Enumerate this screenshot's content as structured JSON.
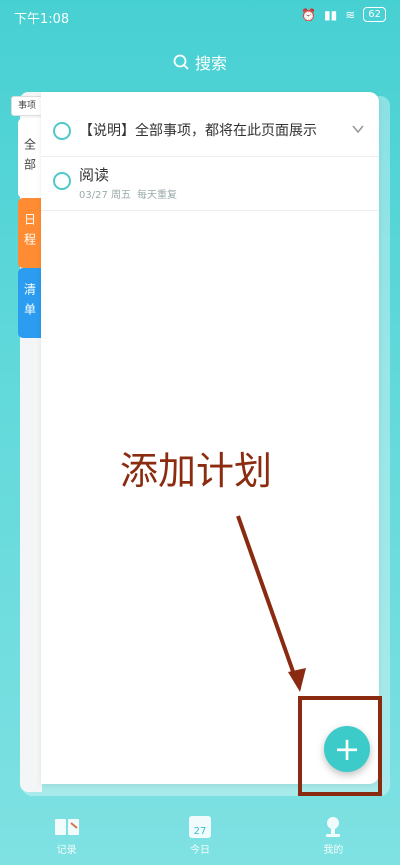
{
  "status": {
    "time": "下午1:08",
    "battery": "62"
  },
  "search": {
    "label": "搜索"
  },
  "side_tabs": {
    "top_label": "事项",
    "all": "全部",
    "schedule": "日程",
    "list": "清单"
  },
  "tasks": [
    {
      "title": "【说明】全部事项，都将在此页面展示"
    },
    {
      "title": "阅读",
      "date": "03/27 周五",
      "repeat": "每天重复"
    }
  ],
  "overlay": {
    "annotation": "添加计划"
  },
  "fab": {
    "symbol": "+"
  },
  "bottom_nav": [
    {
      "label": "记录"
    },
    {
      "label": "今日",
      "calendar_day": "27"
    },
    {
      "label": "我的"
    }
  ]
}
